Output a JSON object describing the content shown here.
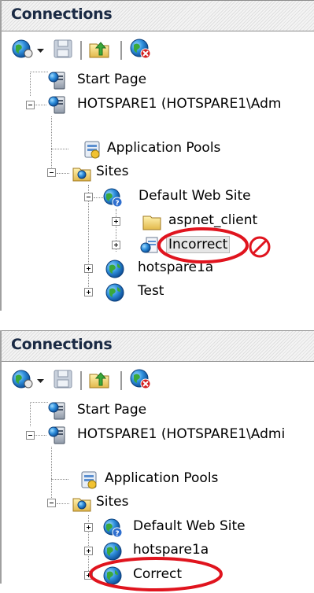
{
  "panel_top": {
    "title": "Connections",
    "toolbar": [
      "connect-globe-icon",
      "dropdown-arrow-icon",
      "save-icon",
      "up-folder-icon",
      "disconnect-icon"
    ],
    "tree": {
      "start_page": "Start Page",
      "server": "HOTSPARE1 (HOTSPARE1\\Adm",
      "app_pools": "Application Pools",
      "sites": "Sites",
      "default_site": "Default Web Site",
      "aspnet_client": "aspnet_client",
      "incorrect": "Incorrect",
      "hotspare1a": "hotspare1a",
      "test": "Test"
    }
  },
  "panel_bottom": {
    "title": "Connections",
    "toolbar": [
      "connect-globe-icon",
      "dropdown-arrow-icon",
      "save-icon",
      "up-folder-icon",
      "disconnect-icon"
    ],
    "tree": {
      "start_page": "Start Page",
      "server": "HOTSPARE1 (HOTSPARE1\\Admi",
      "app_pools": "Application Pools",
      "sites": "Sites",
      "default_site": "Default Web Site",
      "hotspare1a": "hotspare1a",
      "correct": "Correct"
    }
  },
  "colors": {
    "annotation_red": "#e0141e",
    "header_text": "#1a2a44"
  }
}
